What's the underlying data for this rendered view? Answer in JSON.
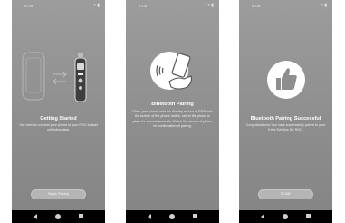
{
  "status_bar": {
    "time": "9:09"
  },
  "screens": [
    {
      "title": "Getting Started",
      "body": "You need to connect your phone to your ROC to start collecting data.",
      "button": "Begin Pairing"
    },
    {
      "title": "Bluetooth Pairing",
      "body": "Place your phone onto the display screen of ROC with the screen of the phone visible, select the phone in place for several seconds. Watch the screen of phone for confirmation of pairing.",
      "button": ""
    },
    {
      "title": "Bluetooth Pairing Successful",
      "body": "Congratulations! You have successfully paired to your Drive DevBox DX ROC.",
      "button": "DONE"
    }
  ]
}
